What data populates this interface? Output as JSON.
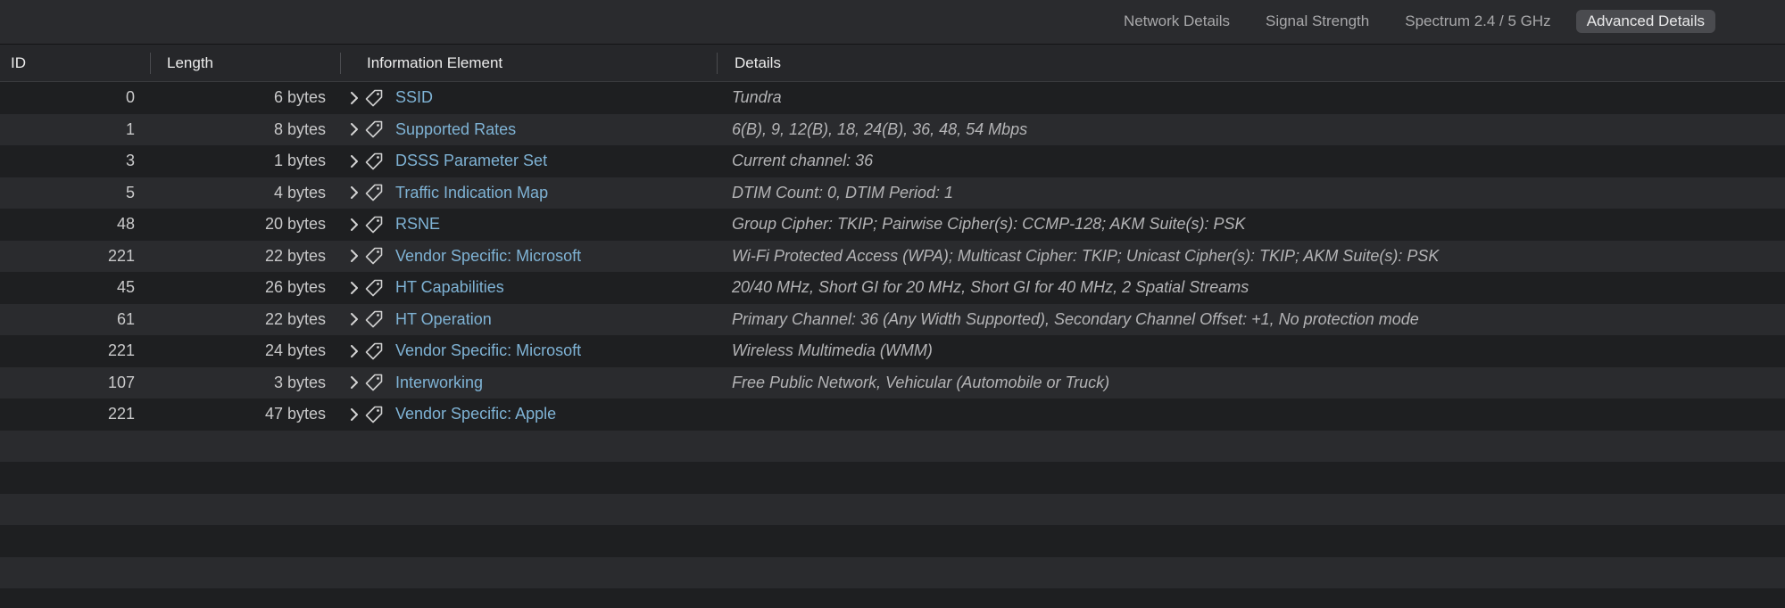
{
  "tabs": [
    {
      "label": "Network Details",
      "active": false
    },
    {
      "label": "Signal Strength",
      "active": false
    },
    {
      "label": "Spectrum 2.4 / 5 GHz",
      "active": false
    },
    {
      "label": "Advanced Details",
      "active": true
    }
  ],
  "columns": {
    "id": "ID",
    "length": "Length",
    "element": "Information Element",
    "details": "Details"
  },
  "rows": [
    {
      "id": "0",
      "length": "6 bytes",
      "name": "SSID",
      "details": "Tundra"
    },
    {
      "id": "1",
      "length": "8 bytes",
      "name": "Supported Rates",
      "details": "6(B), 9, 12(B), 18, 24(B), 36, 48, 54 Mbps"
    },
    {
      "id": "3",
      "length": "1 bytes",
      "name": "DSSS Parameter Set",
      "details": "Current channel: 36"
    },
    {
      "id": "5",
      "length": "4 bytes",
      "name": "Traffic Indication Map",
      "details": "DTIM Count: 0, DTIM Period: 1"
    },
    {
      "id": "48",
      "length": "20 bytes",
      "name": "RSNE",
      "details": "Group Cipher: TKIP; Pairwise Cipher(s): CCMP-128; AKM Suite(s): PSK"
    },
    {
      "id": "221",
      "length": "22 bytes",
      "name": "Vendor Specific: Microsoft",
      "details": "Wi-Fi Protected Access (WPA); Multicast Cipher: TKIP; Unicast Cipher(s): TKIP; AKM Suite(s): PSK"
    },
    {
      "id": "45",
      "length": "26 bytes",
      "name": "HT Capabilities",
      "details": "20/40 MHz, Short GI for 20 MHz, Short GI for 40 MHz, 2 Spatial Streams"
    },
    {
      "id": "61",
      "length": "22 bytes",
      "name": "HT Operation",
      "details": "Primary Channel: 36 (Any Width Supported), Secondary Channel Offset: +1, No protection mode"
    },
    {
      "id": "221",
      "length": "24 bytes",
      "name": "Vendor Specific: Microsoft",
      "details": "Wireless Multimedia (WMM)"
    },
    {
      "id": "107",
      "length": "3 bytes",
      "name": "Interworking",
      "details": "Free Public Network, Vehicular (Automobile or Truck)"
    },
    {
      "id": "221",
      "length": "47 bytes",
      "name": "Vendor Specific: Apple",
      "details": ""
    }
  ],
  "icons": {
    "expand": "chevron-right-icon",
    "element": "tag-icon"
  },
  "colors": {
    "background": "#1e1f21",
    "row_alt": "#2a2b2e",
    "link": "#7fb3d5",
    "active_tab": "#4a4b4f"
  }
}
